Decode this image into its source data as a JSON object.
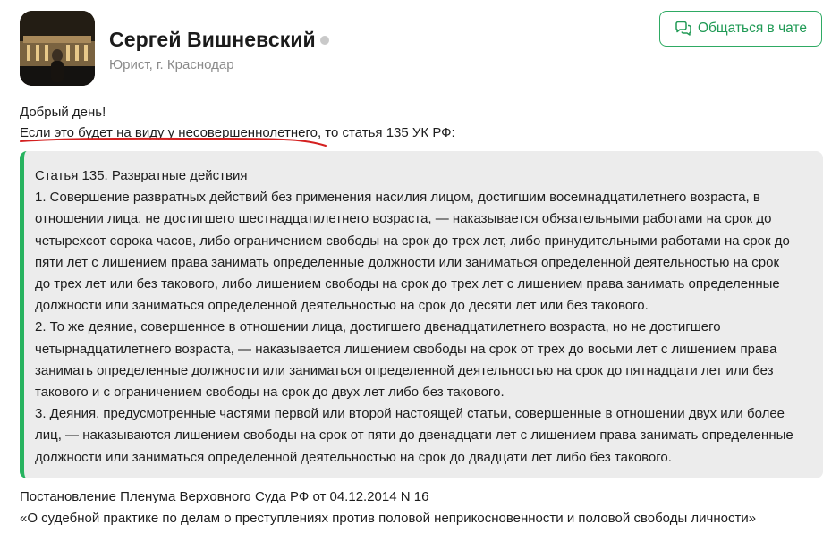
{
  "author": {
    "name": "Сергей Вишневский",
    "subtitle": "Юрист, г. Краснодар",
    "avatar_icon": "avatar-photo-night-building",
    "status": "offline"
  },
  "chat_button": {
    "label": "Общаться в чате",
    "icon": "chat-bubbles-icon",
    "color": "#209a55"
  },
  "answer": {
    "greeting": "Добрый день!",
    "intro": "Если это будет на виду у несовершеннолетнего, то статья 135 УК РФ:",
    "quote_lines": [
      "Статья 135. Развратные действия",
      "1. Совершение развратных действий без применения насилия лицом, достигшим восемнадцатилетнего возраста, в",
      "отношении лица, не достигшего шестнадцатилетнего возраста, — наказывается обязательными работами на срок до",
      "четырехсот сорока часов, либо ограничением свободы на срок до трех лет, либо принудительными работами на срок до",
      "пяти лет с лишением права занимать определенные должности или заниматься определенной деятельностью на срок",
      "до трех лет или без такового, либо лишением свободы на срок до трех лет с лишением права занимать определенные",
      "должности или заниматься определенной деятельностью на срок до десяти лет или без такового.",
      "2. То же деяние, совершенное в отношении лица, достигшего двенадцатилетнего возраста, но не достигшего",
      "четырнадцатилетнего возраста, — наказывается лишением свободы на срок от трех до восьми лет с лишением права",
      "занимать определенные должности или заниматься определенной деятельностью на срок до пятнадцати лет или без",
      "такового и с ограничением свободы на срок до двух лет либо без такового.",
      "3. Деяния, предусмотренные частями первой или второй настоящей статьи, совершенные в отношении двух или более",
      "лиц, — наказываются лишением свободы на срок от пяти до двенадцати лет с лишением права занимать определенные",
      "должности или заниматься определенной деятельностью на срок до двадцати лет либо без такового."
    ],
    "footer_line_1": "Постановление Пленума Верховного Суда РФ от 04.12.2014 N 16",
    "footer_line_2": "«О судебной практике по делам о преступлениях против половой неприкосновенности и половой свободы личности»"
  },
  "colors": {
    "accent_green": "#27b35f",
    "quote_background": "#ececec",
    "underline_red": "#d42020"
  }
}
